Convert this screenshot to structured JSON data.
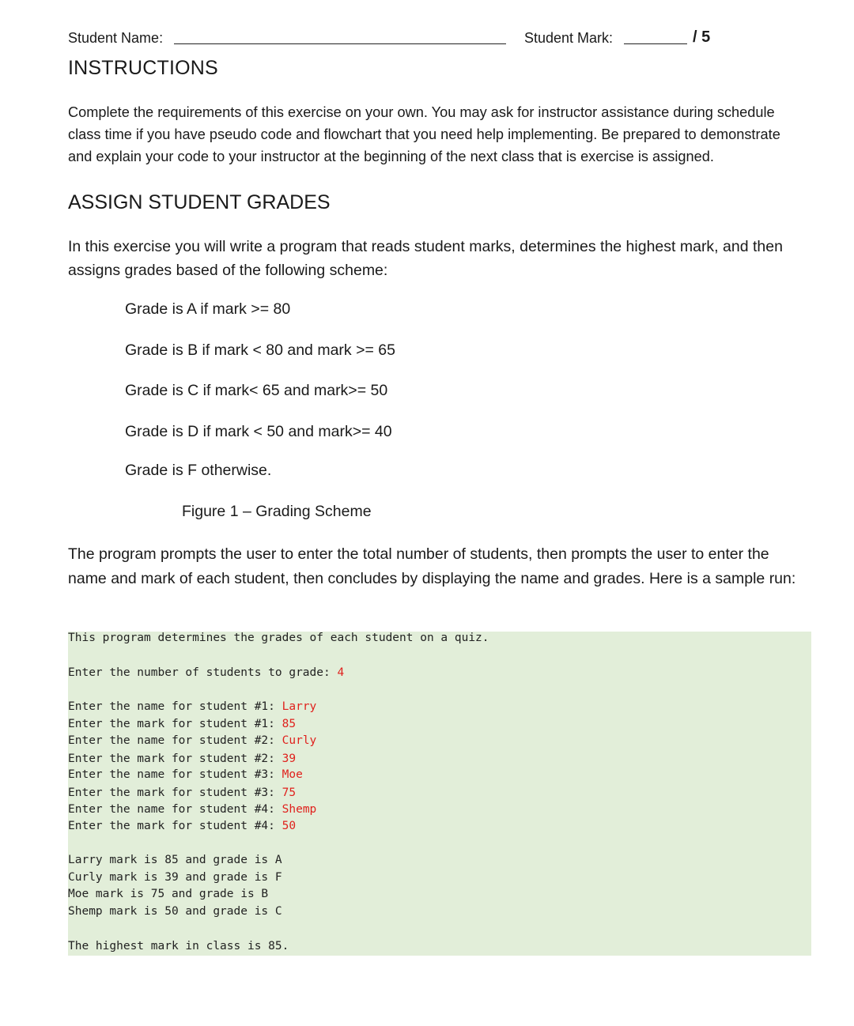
{
  "header": {
    "student_name_label": "Student Name:",
    "student_mark_label": "Student Mark:",
    "mark_total": "/ 5"
  },
  "instructions": {
    "heading": "INSTRUCTIONS",
    "paragraph": "Complete the requirements of this exercise on your own. You may ask for instructor assistance during schedule class time if you have pseudo code and flowchart that you need help implementing. Be prepared to demonstrate and explain your code to your instructor at the beginning of the next class that is exercise is assigned."
  },
  "exercise": {
    "heading": "ASSIGN STUDENT GRADES",
    "intro": "In this exercise you will write a program that reads student marks, determines the highest mark, and then assigns grades based of the following scheme:",
    "scheme": [
      "Grade is A if mark >= 80",
      "Grade is B if mark < 80 and mark >= 65",
      "Grade is C if mark< 65 and mark>= 50",
      "Grade is D if mark < 50 and mark>= 40",
      "Grade is F otherwise."
    ],
    "figure_caption": "Figure 1 – Grading Scheme",
    "program_description": "The program prompts the user to enter the total number of students, then prompts the user to enter the name and mark of each student, then concludes by displaying the name and grades. Here is a sample run:"
  },
  "console": {
    "intro": "This program determines the grades of each student on a quiz.",
    "count_prompt": "Enter the number of students to grade: ",
    "count_input": "4",
    "entries": [
      {
        "prompt": "Enter the name for student #1: ",
        "input": "Larry"
      },
      {
        "prompt": "Enter the mark for student #1: ",
        "input": "85"
      },
      {
        "prompt": "Enter the name for student #2: ",
        "input": "Curly"
      },
      {
        "prompt": "Enter the mark for student #2: ",
        "input": "39"
      },
      {
        "prompt": "Enter the name for student #3: ",
        "input": "Moe"
      },
      {
        "prompt": "Enter the mark for student #3: ",
        "input": "75"
      },
      {
        "prompt": "Enter the name for student #4: ",
        "input": "Shemp"
      },
      {
        "prompt": "Enter the mark for student #4: ",
        "input": "50"
      }
    ],
    "results": [
      "Larry mark is 85 and grade is A",
      "Curly mark is 39 and grade is F",
      "Moe mark is 75 and grade is B",
      "Shemp mark is 50 and grade is C"
    ],
    "summary": "The highest mark in class is 85."
  },
  "colors": {
    "console_background": "#e2eed9",
    "user_input": "#e0211d"
  }
}
